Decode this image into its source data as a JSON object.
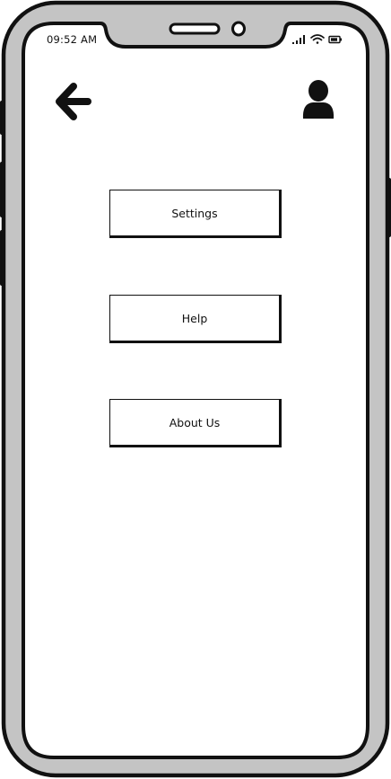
{
  "status_bar": {
    "time": "09:52 AM",
    "icons": [
      "signal-icon",
      "wifi-icon",
      "battery-icon"
    ]
  },
  "header": {
    "back_icon": "back-arrow-icon",
    "profile_icon": "user-profile-icon"
  },
  "menu": {
    "items": [
      {
        "label": "Settings"
      },
      {
        "label": "Help"
      },
      {
        "label": "About Us"
      }
    ]
  },
  "colors": {
    "frame_gray": "#c4c4c4",
    "ink": "#111111",
    "screen": "#ffffff"
  }
}
